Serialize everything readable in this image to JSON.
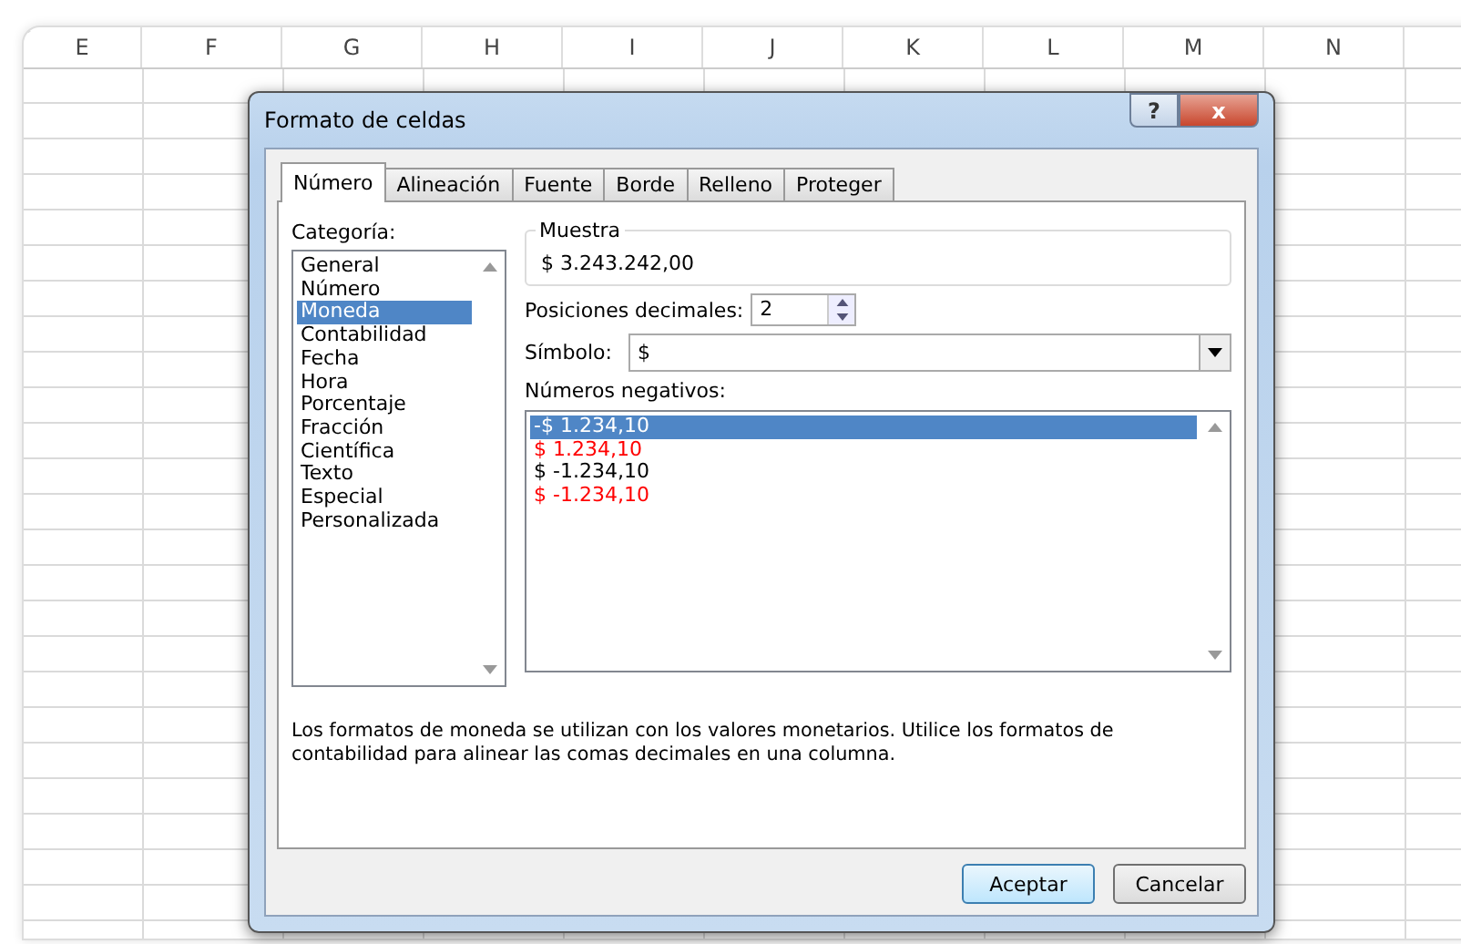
{
  "sheet": {
    "columns": [
      "E",
      "F",
      "G",
      "H",
      "I",
      "J",
      "K",
      "L",
      "M",
      "N"
    ]
  },
  "dialog": {
    "title": "Formato de celdas",
    "help": "?",
    "close": "x",
    "tabs": [
      {
        "label": "Número",
        "selected": true
      },
      {
        "label": "Alineación",
        "selected": false
      },
      {
        "label": "Fuente",
        "selected": false
      },
      {
        "label": "Borde",
        "selected": false
      },
      {
        "label": "Relleno",
        "selected": false
      },
      {
        "label": "Proteger",
        "selected": false
      }
    ],
    "category_label": "Categoría:",
    "categories": [
      {
        "label": "General",
        "selected": false
      },
      {
        "label": "Número",
        "selected": false
      },
      {
        "label": "Moneda",
        "selected": true
      },
      {
        "label": "Contabilidad",
        "selected": false
      },
      {
        "label": "Fecha",
        "selected": false
      },
      {
        "label": "Hora",
        "selected": false
      },
      {
        "label": "Porcentaje",
        "selected": false
      },
      {
        "label": "Fracción",
        "selected": false
      },
      {
        "label": "Científica",
        "selected": false
      },
      {
        "label": "Texto",
        "selected": false
      },
      {
        "label": "Especial",
        "selected": false
      },
      {
        "label": "Personalizada",
        "selected": false
      }
    ],
    "sample": {
      "label": "Muestra",
      "value": "$ 3.243.242,00"
    },
    "decimals": {
      "label": "Posiciones decimales:",
      "value": "2"
    },
    "symbol": {
      "label": "Símbolo:",
      "value": "$"
    },
    "negatives_label": "Números negativos:",
    "negatives": [
      {
        "label": "-$ 1.234,10",
        "selected": true,
        "color": "#ffffff"
      },
      {
        "label": "$ 1.234,10",
        "selected": false,
        "color": "#ff0000"
      },
      {
        "label": "$ -1.234,10",
        "selected": false,
        "color": "#000000"
      },
      {
        "label": "$ -1.234,10",
        "selected": false,
        "color": "#ff0000"
      }
    ],
    "description": "Los formatos de moneda se utilizan con los valores monetarios. Utilice los formatos de contabilidad para alinear las comas decimales en una columna.",
    "buttons": [
      "Aceptar",
      "Cancelar"
    ]
  }
}
